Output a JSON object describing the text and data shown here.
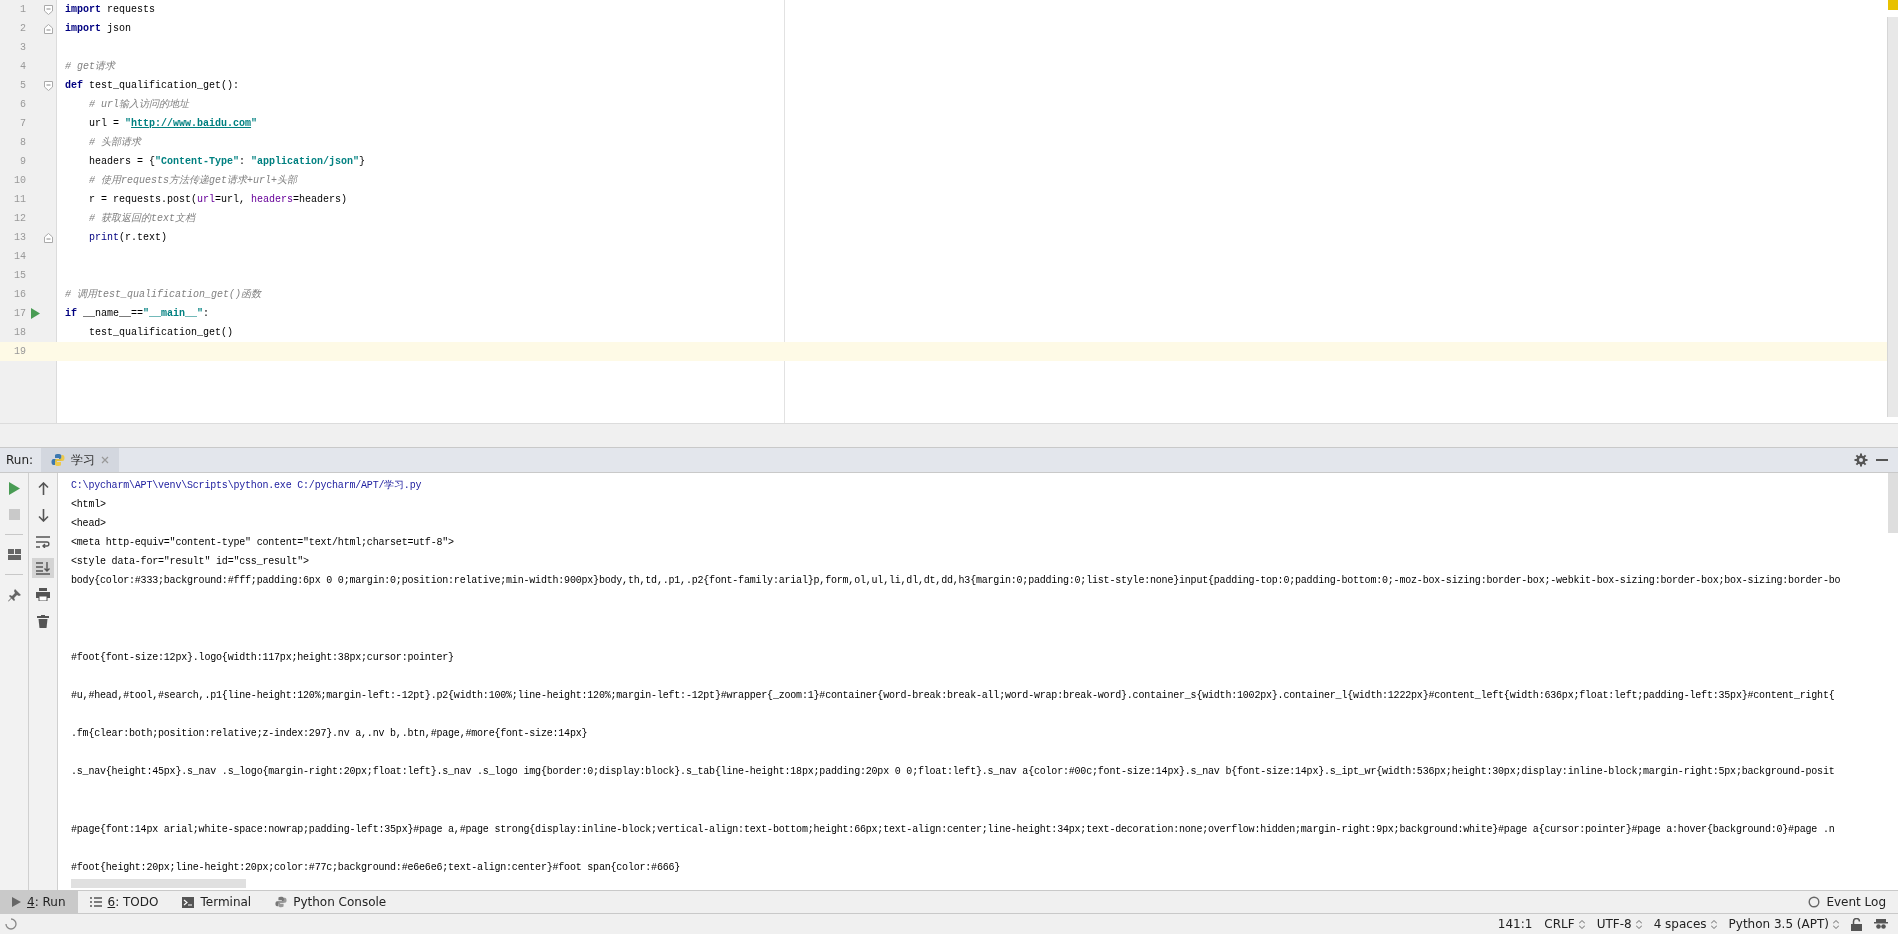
{
  "editor": {
    "lines": [
      {
        "number": "1",
        "fold_start": true,
        "fold_end": false,
        "run_marker": false,
        "current": false,
        "indented": false,
        "tokens": [
          {
            "kind": "keyword",
            "text": "import"
          },
          {
            "kind": "plain",
            "text": " requests"
          }
        ]
      },
      {
        "number": "2",
        "fold_start": false,
        "fold_end": true,
        "run_marker": false,
        "current": false,
        "indented": false,
        "tokens": [
          {
            "kind": "keyword",
            "text": "import"
          },
          {
            "kind": "plain",
            "text": " json"
          }
        ]
      },
      {
        "number": "3",
        "fold_start": false,
        "fold_end": false,
        "run_marker": false,
        "current": false
      },
      {
        "number": "4",
        "fold_start": false,
        "fold_end": false,
        "run_marker": false,
        "current": false,
        "indented": false,
        "tokens": [
          {
            "kind": "comment",
            "text": "# get请求"
          }
        ]
      },
      {
        "number": "5",
        "fold_start": true,
        "fold_end": false,
        "run_marker": false,
        "current": false,
        "indented": false,
        "tokens": [
          {
            "kind": "keyword",
            "text": "def"
          },
          {
            "kind": "plain",
            "text": " test_qualification_get():"
          }
        ]
      },
      {
        "number": "6",
        "fold_start": false,
        "fold_end": false,
        "run_marker": false,
        "current": false,
        "indented": true,
        "tokens": [
          {
            "kind": "comment",
            "text": "# url输入访问的地址"
          }
        ]
      },
      {
        "number": "7",
        "fold_start": false,
        "fold_end": false,
        "run_marker": false,
        "current": false,
        "indented": true,
        "tokens": [
          {
            "kind": "plain",
            "text": "url = "
          },
          {
            "kind": "string",
            "text": "\""
          },
          {
            "kind": "link",
            "text": "http://www.baidu.com"
          },
          {
            "kind": "string",
            "text": "\""
          }
        ]
      },
      {
        "number": "8",
        "fold_start": false,
        "fold_end": false,
        "run_marker": false,
        "current": false,
        "indented": true,
        "tokens": [
          {
            "kind": "comment",
            "text": "# 头部请求"
          }
        ]
      },
      {
        "number": "9",
        "fold_start": false,
        "fold_end": false,
        "run_marker": false,
        "current": false,
        "indented": true,
        "tokens": [
          {
            "kind": "plain",
            "text": "headers = {"
          },
          {
            "kind": "string",
            "text": "\"Content-Type\""
          },
          {
            "kind": "plain",
            "text": ": "
          },
          {
            "kind": "string",
            "text": "\"application/json\""
          },
          {
            "kind": "plain",
            "text": "}"
          }
        ]
      },
      {
        "number": "10",
        "fold_start": false,
        "fold_end": false,
        "run_marker": false,
        "current": false,
        "indented": true,
        "tokens": [
          {
            "kind": "comment",
            "text": "# 使用requests方法传递get请求+url+头部"
          }
        ]
      },
      {
        "number": "11",
        "fold_start": false,
        "fold_end": false,
        "run_marker": false,
        "current": false,
        "indented": true,
        "tokens": [
          {
            "kind": "plain",
            "text": "r = requests.post("
          },
          {
            "kind": "param",
            "text": "url"
          },
          {
            "kind": "plain",
            "text": "=url, "
          },
          {
            "kind": "param",
            "text": "headers"
          },
          {
            "kind": "plain",
            "text": "=headers)"
          }
        ]
      },
      {
        "number": "12",
        "fold_start": false,
        "fold_end": false,
        "run_marker": false,
        "current": false,
        "indented": true,
        "tokens": [
          {
            "kind": "comment",
            "text": "# 获取返回的text文档"
          }
        ]
      },
      {
        "number": "13",
        "fold_start": false,
        "fold_end": true,
        "run_marker": false,
        "current": false,
        "indented": true,
        "tokens": [
          {
            "kind": "builtin",
            "text": "print"
          },
          {
            "kind": "plain",
            "text": "(r.text)"
          }
        ]
      },
      {
        "number": "14",
        "fold_start": false,
        "fold_end": false,
        "run_marker": false,
        "current": false
      },
      {
        "number": "15",
        "fold_start": false,
        "fold_end": false,
        "run_marker": false,
        "current": false
      },
      {
        "number": "16",
        "fold_start": false,
        "fold_end": false,
        "run_marker": false,
        "current": false,
        "indented": false,
        "tokens": [
          {
            "kind": "comment",
            "text": "# 调用test_qualification_get()函数"
          }
        ]
      },
      {
        "number": "17",
        "fold_start": false,
        "fold_end": false,
        "run_marker": true,
        "current": false,
        "indented": false,
        "tokens": [
          {
            "kind": "keyword",
            "text": "if"
          },
          {
            "kind": "plain",
            "text": " __name__=="
          },
          {
            "kind": "string",
            "text": "\"__main__\""
          },
          {
            "kind": "plain",
            "text": ":"
          }
        ]
      },
      {
        "number": "18",
        "fold_start": false,
        "fold_end": false,
        "run_marker": false,
        "current": false,
        "indented": true,
        "tokens": [
          {
            "kind": "plain",
            "text": "test_qualification_get()"
          }
        ]
      },
      {
        "number": "19",
        "fold_start": false,
        "fold_end": false,
        "run_marker": false,
        "current": true
      }
    ]
  },
  "run_panel": {
    "label": "Run:",
    "tabs": [
      {
        "label": "学习",
        "selected": true
      }
    ],
    "autoscroll_on": true,
    "output": [
      {
        "kind": "command",
        "text": "C:\\pycharm\\APT\\venv\\Scripts\\python.exe C:/pycharm/APT/学习.py"
      },
      {
        "kind": "text",
        "text": "<html>"
      },
      {
        "kind": "text",
        "text": "<head>"
      },
      {
        "kind": "text",
        "text": "<meta http-equiv=\"content-type\" content=\"text/html;charset=utf-8\">"
      },
      {
        "kind": "text",
        "text": "<style data-for=\"result\" id=\"css_result\">"
      },
      {
        "kind": "text",
        "text": "body{color:#333;background:#fff;padding:6px 0 0;margin:0;position:relative;min-width:900px}body,th,td,.p1,.p2{font-family:arial}p,form,ol,ul,li,dl,dt,dd,h3{margin:0;padding:0;list-style:none}input{padding-top:0;padding-bottom:0;-moz-box-sizing:border-box;-webkit-box-sizing:border-box;box-sizing:border-bo"
      },
      {
        "kind": "blank"
      },
      {
        "kind": "blank"
      },
      {
        "kind": "blank"
      },
      {
        "kind": "text",
        "text": "#foot{font-size:12px}.logo{width:117px;height:38px;cursor:pointer}"
      },
      {
        "kind": "blank"
      },
      {
        "kind": "text",
        "text": "#u,#head,#tool,#search,.p1{line-height:120%;margin-left:-12pt}.p2{width:100%;line-height:120%;margin-left:-12pt}#wrapper{_zoom:1}#container{word-break:break-all;word-wrap:break-word}.container_s{width:1002px}.container_l{width:1222px}#content_left{width:636px;float:left;padding-left:35px}#content_right{"
      },
      {
        "kind": "blank"
      },
      {
        "kind": "text",
        "text": ".fm{clear:both;position:relative;z-index:297}.nv a,.nv b,.btn,#page,#more{font-size:14px}"
      },
      {
        "kind": "blank"
      },
      {
        "kind": "text",
        "text": ".s_nav{height:45px}.s_nav .s_logo{margin-right:20px;float:left}.s_nav .s_logo img{border:0;display:block}.s_tab{line-height:18px;padding:20px 0 0;float:left}.s_nav a{color:#00c;font-size:14px}.s_nav b{font-size:14px}.s_ipt_wr{width:536px;height:30px;display:inline-block;margin-right:5px;background-posit"
      },
      {
        "kind": "blank"
      },
      {
        "kind": "blank"
      },
      {
        "kind": "text",
        "text": "#page{font:14px arial;white-space:nowrap;padding-left:35px}#page a,#page strong{display:inline-block;vertical-align:text-bottom;height:66px;text-align:center;line-height:34px;text-decoration:none;overflow:hidden;margin-right:9px;background:white}#page a{cursor:pointer}#page a:hover{background:0}#page .n"
      },
      {
        "kind": "blank"
      },
      {
        "kind": "text",
        "text": "#foot{height:20px;line-height:20px;color:#77c;background:#e6e6e6;text-align:center}#foot span{color:#666}"
      }
    ]
  },
  "tool_tabs": [
    {
      "mnemonic": "4",
      "label": ": Run",
      "selected": true
    },
    {
      "mnemonic": "6",
      "label": ": TODO",
      "selected": false
    },
    {
      "label": "Terminal",
      "selected": false
    },
    {
      "label": "Python Console",
      "selected": false
    }
  ],
  "event_log": "Event Log",
  "status_bar": {
    "items": [
      "141:1",
      "CRLF",
      "UTF-8",
      "4 spaces",
      "Python 3.5 (APT)"
    ]
  }
}
